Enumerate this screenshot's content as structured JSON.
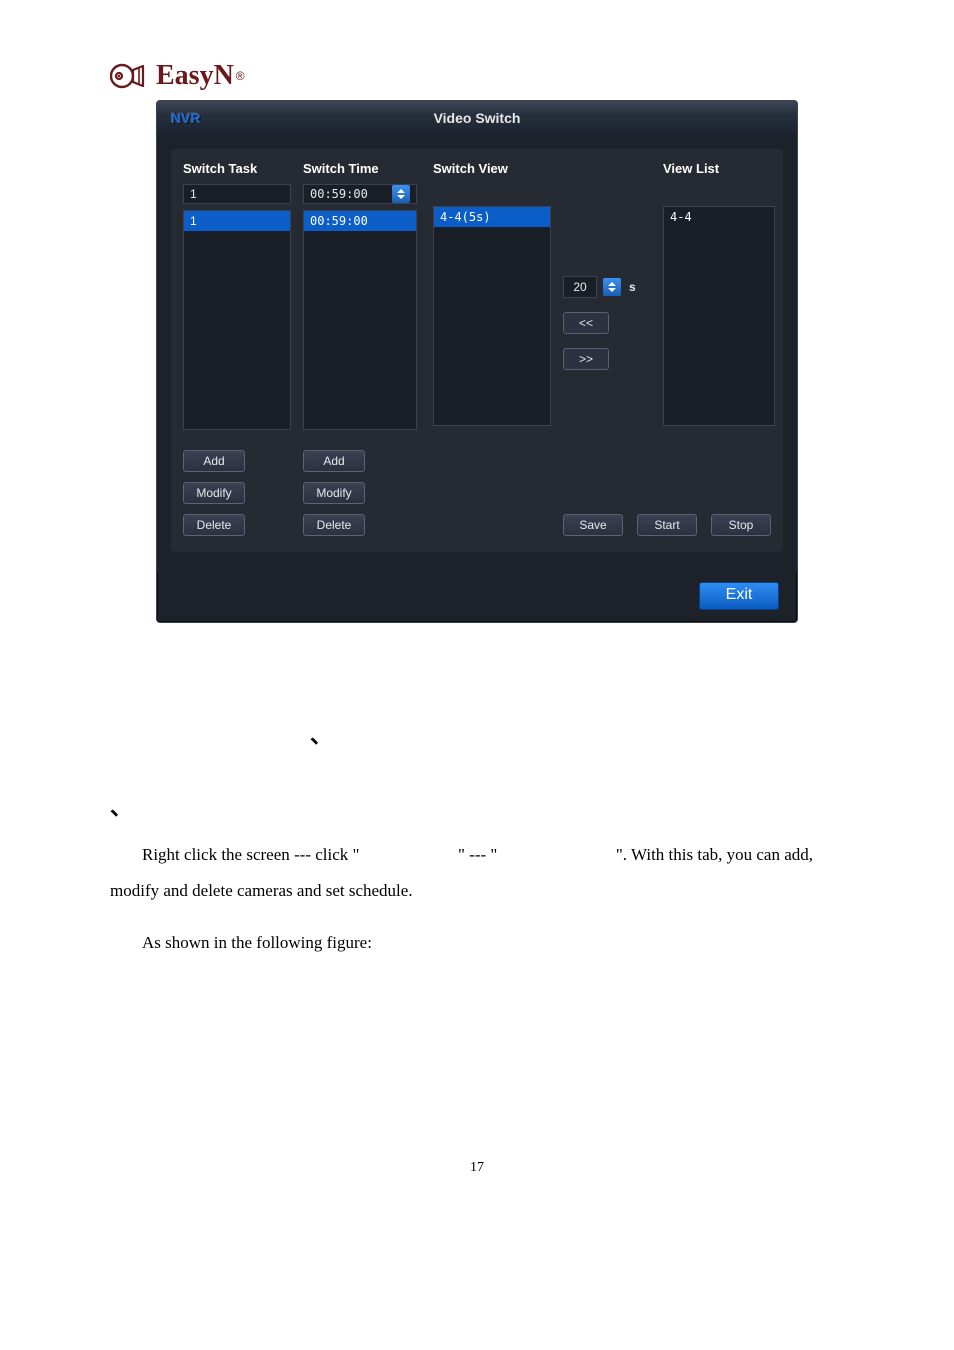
{
  "brand": {
    "name": "EasyN",
    "reg": "®"
  },
  "window": {
    "app_badge": "NVR",
    "title": "Video Switch"
  },
  "headers": {
    "switch_task": "Switch Task",
    "switch_time": "Switch Time",
    "switch_view": "Switch View",
    "view_list": "View List"
  },
  "switch_task": {
    "input_value": "1",
    "list": [
      "1"
    ]
  },
  "switch_time": {
    "input_value": "00:59:00",
    "list": [
      "00:59:00"
    ]
  },
  "switch_view": {
    "list": [
      "4-4(5s)"
    ]
  },
  "view_list": {
    "list": [
      "4-4"
    ]
  },
  "interval": {
    "value": "20",
    "unit": "s"
  },
  "move": {
    "left": "<<",
    "right": ">>"
  },
  "buttons": {
    "add": "Add",
    "modify": "Modify",
    "delete": "Delete",
    "save": "Save",
    "start": "Start",
    "stop": "Stop",
    "exit": "Exit"
  },
  "doc": {
    "mark1": "、",
    "mark2": "、",
    "para1a": "Right click the screen --- click \"",
    "para1b": "\" --- \"",
    "para1c": "\". With this tab, you can add, modify and delete cameras and set schedule.",
    "para2": "As shown in the following figure:",
    "page_number": "17"
  }
}
